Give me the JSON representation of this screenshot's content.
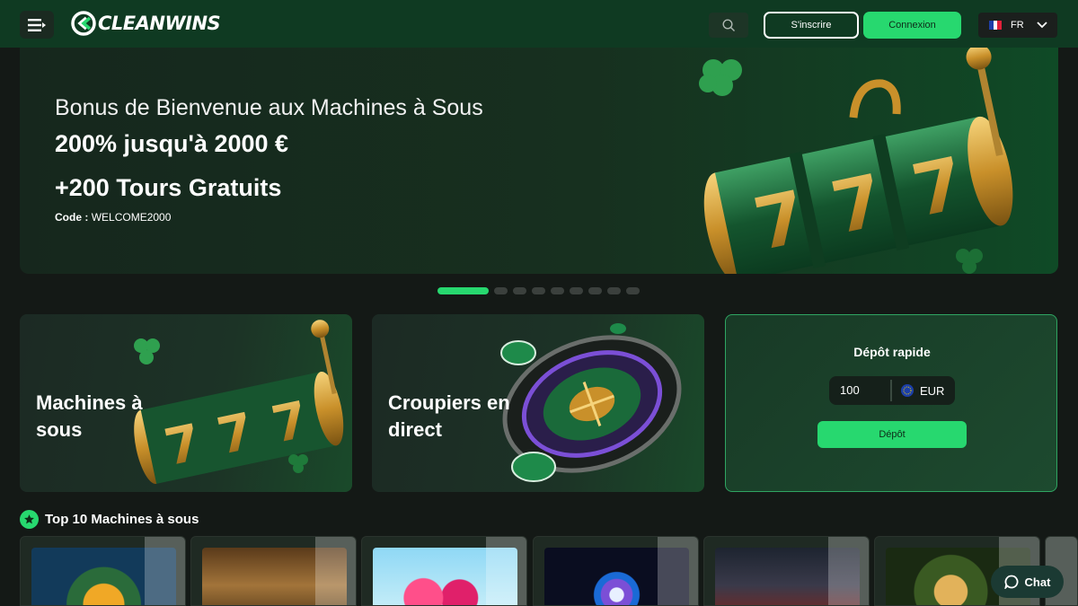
{
  "header": {
    "logo_text": "CLEANWINS",
    "signup_label": "S'inscrire",
    "login_label": "Connexion",
    "language": "FR"
  },
  "hero": {
    "line1": "Bonus de Bienvenue aux Machines à Sous",
    "line2": "200% jusqu'à 2000 €",
    "line3": "+200 Tours Gratuits",
    "code_label": "Code :",
    "code_value": "WELCOME2000"
  },
  "carousel": {
    "slides": 9,
    "active": 1
  },
  "categories": [
    {
      "label": "Machines à sous"
    },
    {
      "label": "Croupiers en direct"
    }
  ],
  "deposit": {
    "title": "Dépôt rapide",
    "amount": "100",
    "currency": "EUR",
    "button_label": "Dépôt"
  },
  "top10": {
    "title": "Top 10 Machines à sous"
  },
  "games": [
    {
      "name": "game-1"
    },
    {
      "name": "game-2"
    },
    {
      "name": "game-3"
    },
    {
      "name": "game-4"
    },
    {
      "name": "game-5"
    },
    {
      "name": "game-6"
    }
  ],
  "chat": {
    "label": "Chat"
  },
  "colors": {
    "accent": "#27d86f",
    "header_bg": "#0f3a22",
    "page_bg": "#141916"
  }
}
